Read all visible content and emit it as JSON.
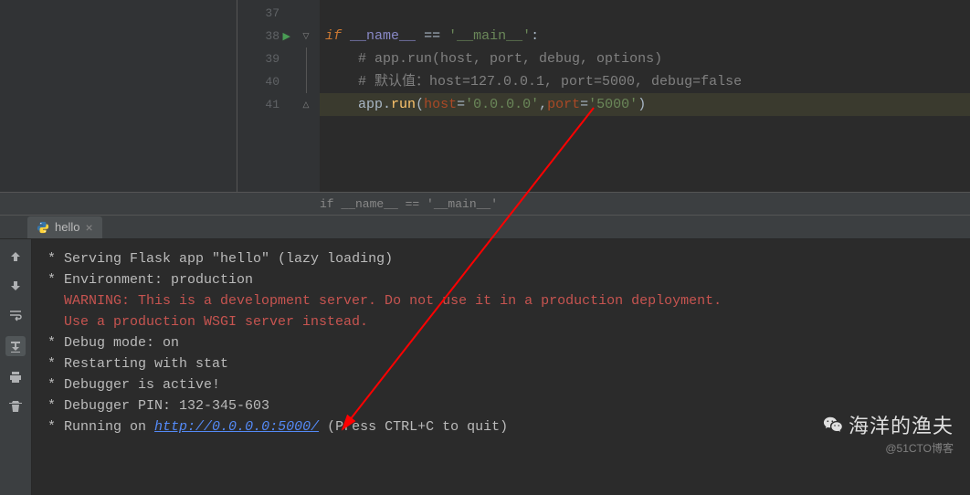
{
  "editor": {
    "lines": [
      {
        "num": "37",
        "run": false
      },
      {
        "num": "38",
        "run": true
      },
      {
        "num": "39",
        "run": false
      },
      {
        "num": "40",
        "run": false
      },
      {
        "num": "41",
        "run": false
      }
    ],
    "code": {
      "l38": {
        "kw": "if",
        "name": "__name__",
        "op": "==",
        "str": "'__main__'",
        "colon": ":"
      },
      "l39": {
        "comment": "# app.run(host, port, debug, options)"
      },
      "l40": {
        "comment": "# 默认值：host=127.0.0.1, port=5000, debug=false"
      },
      "l41": {
        "obj": "app",
        "method": "run",
        "p1name": "host",
        "p1val": "'0.0.0.0'",
        "p2name": "port",
        "p2val": "'5000'"
      }
    },
    "breadcrumb": "if __name__ == '__main__'"
  },
  "tab": {
    "name": "hello"
  },
  "console": {
    "l1": {
      "prefix": " * ",
      "text": "Serving Flask app \"hello\" (lazy loading)"
    },
    "l2": {
      "prefix": " * ",
      "text": "Environment: production"
    },
    "l3": {
      "text": "   WARNING: This is a development server. Do not use it in a production deployment."
    },
    "l4": {
      "text": "   Use a production WSGI server instead."
    },
    "l5": {
      "prefix": " * ",
      "text": "Debug mode: on"
    },
    "l6": {
      "prefix": " * ",
      "text": "Restarting with stat"
    },
    "l7": {
      "prefix": " * ",
      "text": "Debugger is active!"
    },
    "l8": {
      "prefix": " * ",
      "text": "Debugger PIN: 132-345-603"
    },
    "l9": {
      "prefix": " * ",
      "pre": "Running on ",
      "url": "http://0.0.0.0:5000/",
      "post": " (Press CTRL+C to quit)"
    }
  },
  "watermark": {
    "main": "海洋的渔夫",
    "sub": "@51CTO博客"
  }
}
